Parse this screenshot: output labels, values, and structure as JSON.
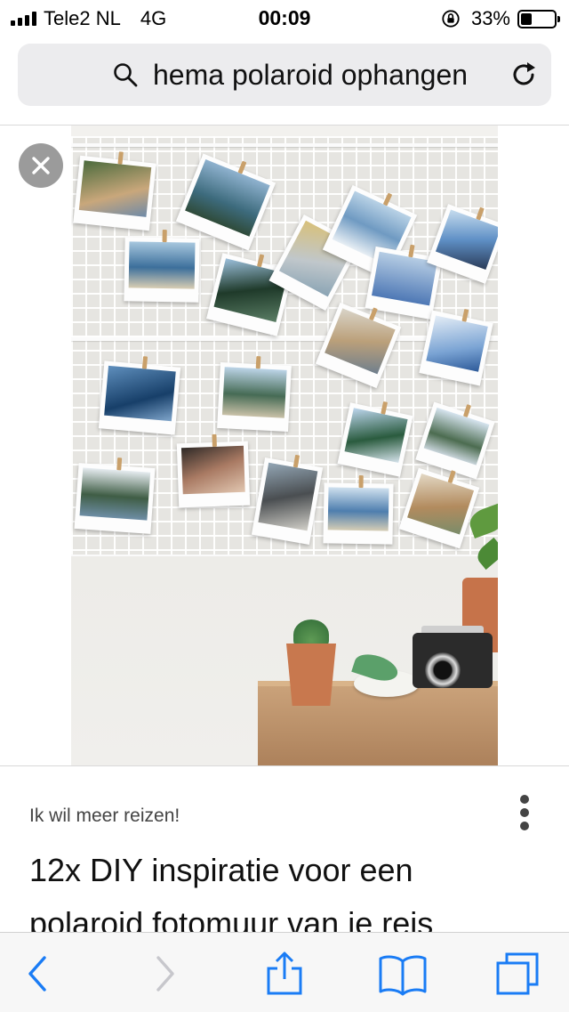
{
  "status_bar": {
    "carrier": "Tele2 NL",
    "network": "4G",
    "time": "00:09",
    "battery": "33%",
    "battery_level": 0.33
  },
  "url_bar": {
    "query": "hema polaroid ophangen",
    "search_icon": "search-icon",
    "reload_icon": "reload-icon"
  },
  "result": {
    "close_icon": "close-icon",
    "image": "photo-grid-polaroid-wall",
    "source": "Ik wil meer reizen!",
    "title": "12x DIY inspiratie voor een polaroid fotomuur van je reis",
    "more_icon": "more-vertical-icon"
  },
  "toolbar": {
    "back_icon": "back-chevron-icon",
    "forward_icon": "forward-chevron-icon",
    "share_icon": "share-icon",
    "bookmarks_icon": "bookmarks-icon",
    "tabs_icon": "tabs-icon"
  },
  "colors": {
    "accent": "#1a7cf5",
    "disabled": "#c7c7cc",
    "url_bar_bg": "#ececee"
  }
}
